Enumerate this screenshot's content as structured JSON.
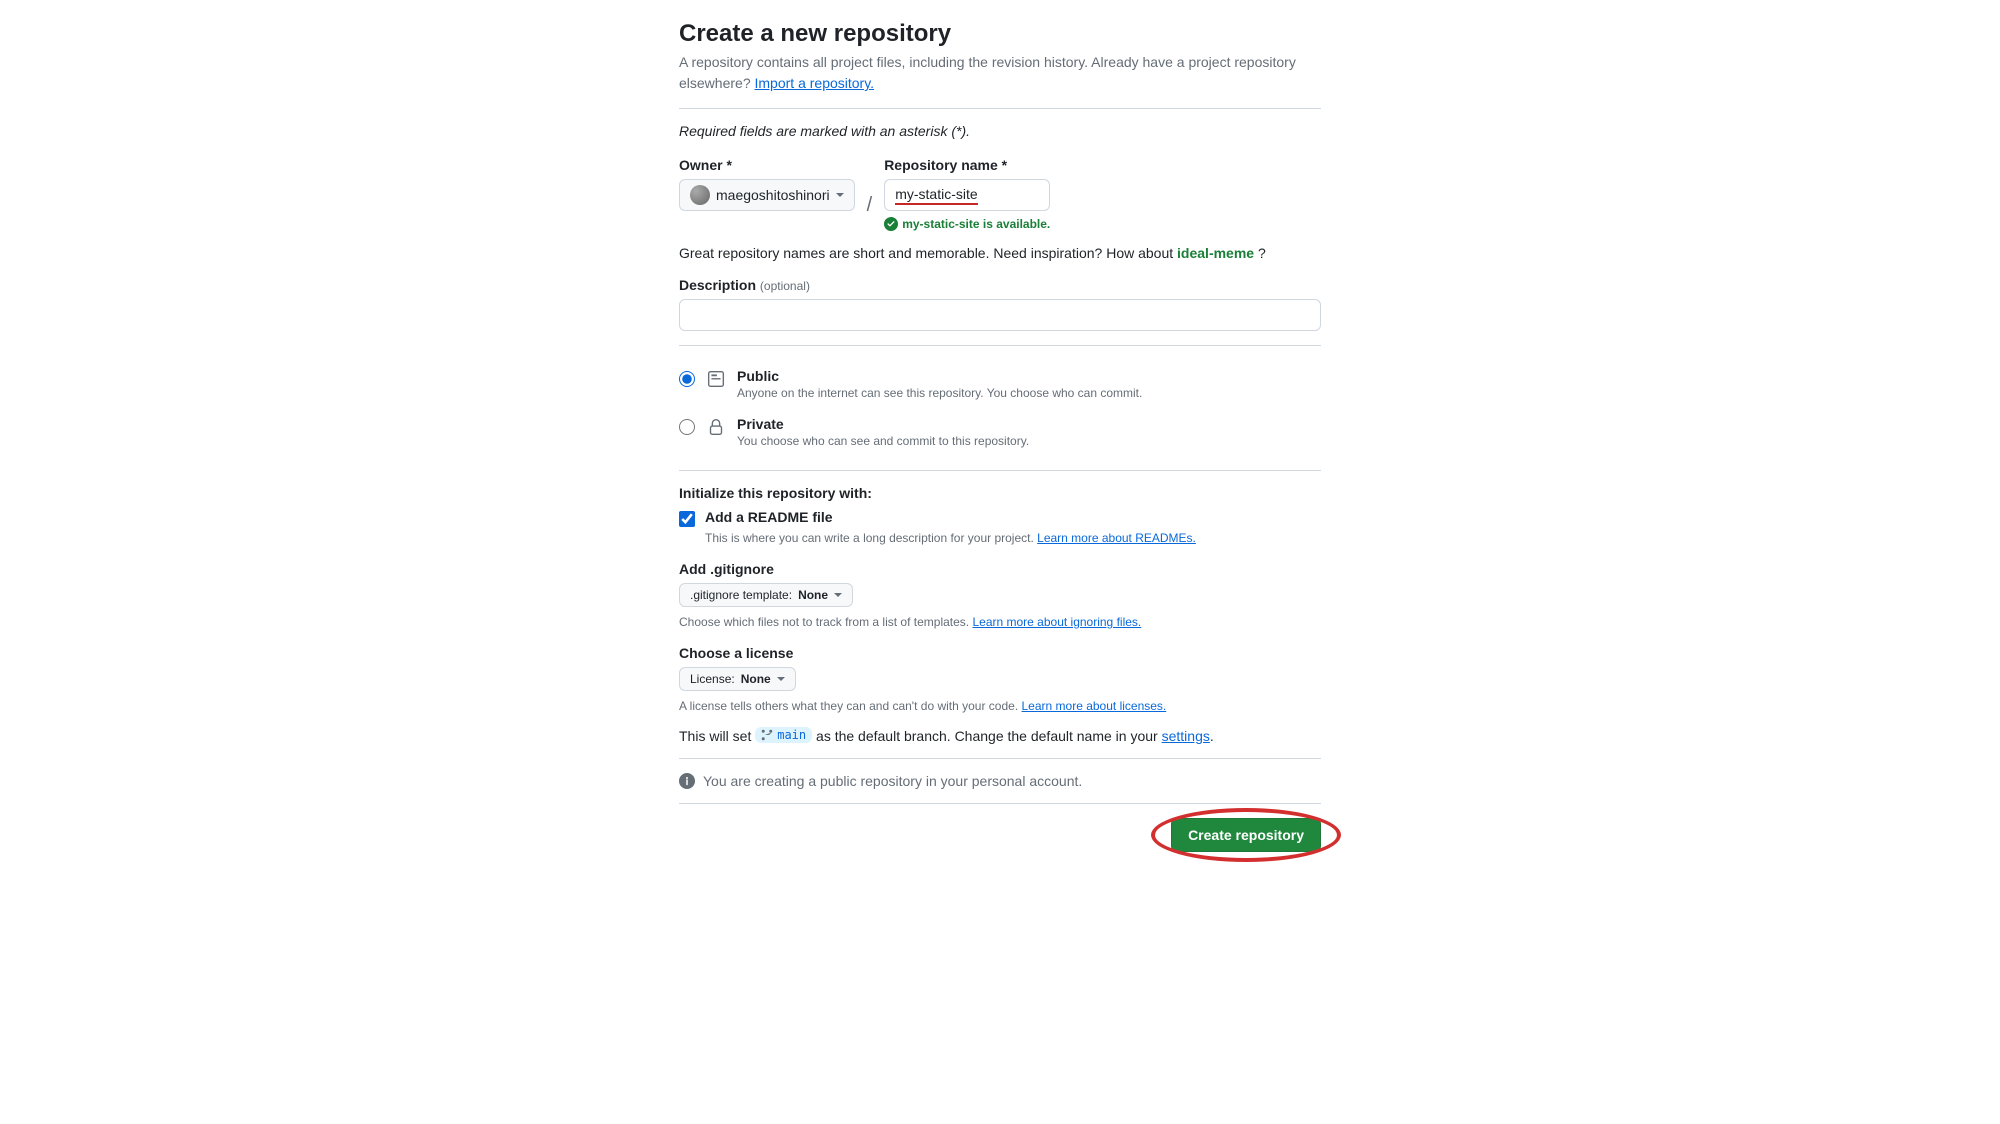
{
  "header": {
    "title": "Create a new repository",
    "subtitle_a": "A repository contains all project files, including the revision history. Already have a project repository elsewhere? ",
    "import_link": "Import a repository.",
    "required_note": "Required fields are marked with an asterisk (*)."
  },
  "owner": {
    "label": "Owner *",
    "value": "maegoshitoshinori"
  },
  "repo": {
    "label": "Repository name *",
    "value": "my-static-site",
    "available_text": "my-static-site is available."
  },
  "suggest": {
    "prefix": "Great repository names are short and memorable. Need inspiration? How about ",
    "name": "ideal-meme",
    "suffix": " ?"
  },
  "description": {
    "label": "Description ",
    "optional": "(optional)",
    "value": ""
  },
  "visibility": {
    "public_title": "Public",
    "public_desc": "Anyone on the internet can see this repository. You choose who can commit.",
    "private_title": "Private",
    "private_desc": "You choose who can see and commit to this repository."
  },
  "init": {
    "title": "Initialize this repository with:",
    "readme_label": "Add a README file",
    "readme_desc": "This is where you can write a long description for your project. ",
    "readme_link": "Learn more about READMEs."
  },
  "gitignore": {
    "label": "Add .gitignore",
    "btn_prefix": ".gitignore template: ",
    "btn_value": "None",
    "hint": "Choose which files not to track from a list of templates. ",
    "link": "Learn more about ignoring files."
  },
  "license": {
    "label": "Choose a license",
    "btn_prefix": "License: ",
    "btn_value": "None",
    "hint": "A license tells others what they can and can't do with your code. ",
    "link": "Learn more about licenses."
  },
  "branch": {
    "prefix": "This will set ",
    "name": "main",
    "mid": " as the default branch. Change the default name in your ",
    "link": "settings",
    "suffix": "."
  },
  "info": {
    "text": "You are creating a public repository in your personal account."
  },
  "footer": {
    "create": "Create repository"
  }
}
